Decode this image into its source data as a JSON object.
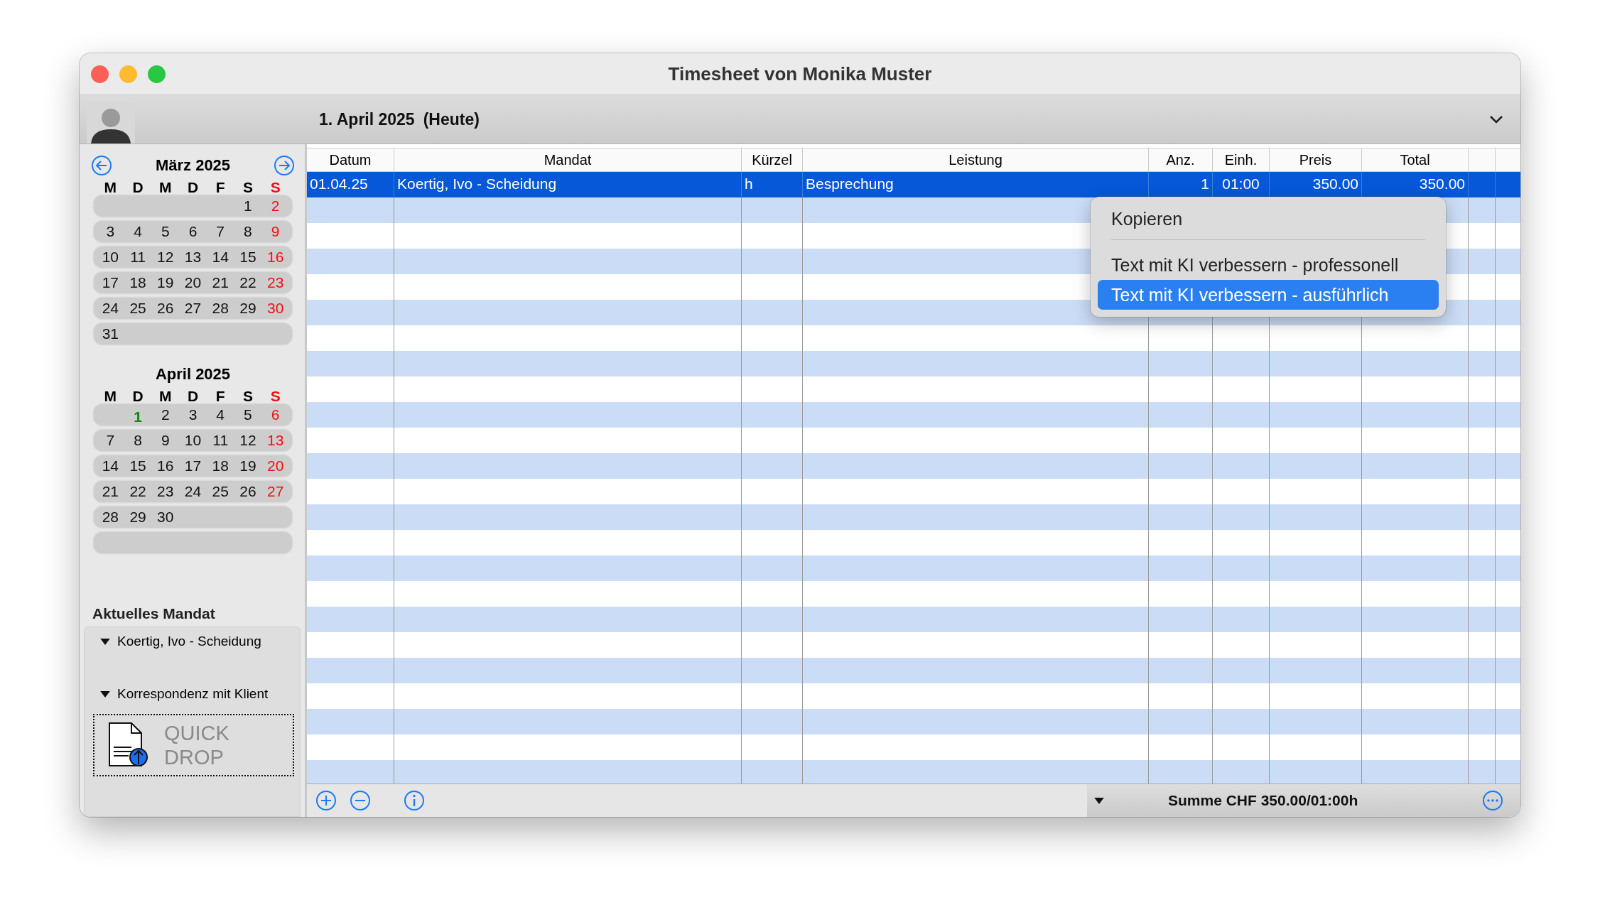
{
  "window": {
    "title": "Timesheet von Monika Muster"
  },
  "header": {
    "date": "1. April 2025",
    "note": "(Heute)"
  },
  "calendar": {
    "months": [
      {
        "title": "März 2025",
        "weekdays": [
          "M",
          "D",
          "M",
          "D",
          "F",
          "S",
          "S"
        ],
        "weeks": [
          {
            "days": [
              {
                "n": "1"
              },
              {
                "n": "2"
              }
            ]
          },
          {
            "days": [
              {
                "n": "3"
              },
              {
                "n": "4"
              },
              {
                "n": "5"
              },
              {
                "n": "6"
              },
              {
                "n": "7"
              },
              {
                "n": "8"
              },
              {
                "n": "9"
              }
            ]
          },
          {
            "days": [
              {
                "n": "10"
              },
              {
                "n": "11"
              },
              {
                "n": "12"
              },
              {
                "n": "13"
              },
              {
                "n": "14"
              },
              {
                "n": "15"
              },
              {
                "n": "16"
              }
            ]
          },
          {
            "days": [
              {
                "n": "17"
              },
              {
                "n": "18"
              },
              {
                "n": "19"
              },
              {
                "n": "20"
              },
              {
                "n": "21"
              },
              {
                "n": "22"
              },
              {
                "n": "23"
              }
            ]
          },
          {
            "days": [
              {
                "n": "24"
              },
              {
                "n": "25"
              },
              {
                "n": "26"
              },
              {
                "n": "27"
              },
              {
                "n": "28"
              },
              {
                "n": "29"
              },
              {
                "n": "30"
              }
            ]
          },
          {
            "days": [
              {
                "n": "31"
              }
            ]
          }
        ]
      },
      {
        "title": "April 2025",
        "weekdays": [
          "M",
          "D",
          "M",
          "D",
          "F",
          "S",
          "S"
        ],
        "weeks": [
          {
            "days": [
              {
                "n": "1",
                "today": true
              },
              {
                "n": "2"
              },
              {
                "n": "3"
              },
              {
                "n": "4"
              },
              {
                "n": "5"
              },
              {
                "n": "6"
              }
            ]
          },
          {
            "days": [
              {
                "n": "7"
              },
              {
                "n": "8"
              },
              {
                "n": "9"
              },
              {
                "n": "10"
              },
              {
                "n": "11"
              },
              {
                "n": "12"
              },
              {
                "n": "13"
              }
            ]
          },
          {
            "days": [
              {
                "n": "14"
              },
              {
                "n": "15"
              },
              {
                "n": "16"
              },
              {
                "n": "17"
              },
              {
                "n": "18"
              },
              {
                "n": "19"
              },
              {
                "n": "20"
              }
            ]
          },
          {
            "days": [
              {
                "n": "21"
              },
              {
                "n": "22"
              },
              {
                "n": "23"
              },
              {
                "n": "24"
              },
              {
                "n": "25"
              },
              {
                "n": "26"
              },
              {
                "n": "27"
              }
            ]
          },
          {
            "days": [
              {
                "n": "28"
              },
              {
                "n": "29"
              },
              {
                "n": "30"
              }
            ]
          }
        ]
      }
    ]
  },
  "current_mandate": {
    "title": "Aktuelles Mandat",
    "items": [
      {
        "label": "Koertig, Ivo - Scheidung",
        "expanded": true
      },
      {
        "label": "Korrespondenz mit Klient",
        "expanded": true
      }
    ]
  },
  "quick_drop": {
    "lines": [
      "QUICK",
      "DROP"
    ]
  },
  "table": {
    "columns": [
      "Datum",
      "Mandat",
      "Kürzel",
      "Leistung",
      "Anz.",
      "Einh.",
      "Preis",
      "Total"
    ],
    "rows": [
      {
        "selected": true,
        "cells": [
          "01.04.25",
          "Koertig, Ivo - Scheidung",
          "h",
          "Besprechung",
          "1",
          "01:00",
          "350.00",
          "350.00"
        ]
      }
    ]
  },
  "context_menu": {
    "groups": [
      [
        {
          "label": "Kopieren",
          "selected": false
        }
      ],
      [
        {
          "label": "Text mit KI verbessern - professonell",
          "selected": false
        },
        {
          "label": "Text mit KI verbessern - ausführlich",
          "selected": true
        }
      ]
    ]
  },
  "status_bar": {
    "sum": "Summe CHF 350.00/01:00h"
  }
}
